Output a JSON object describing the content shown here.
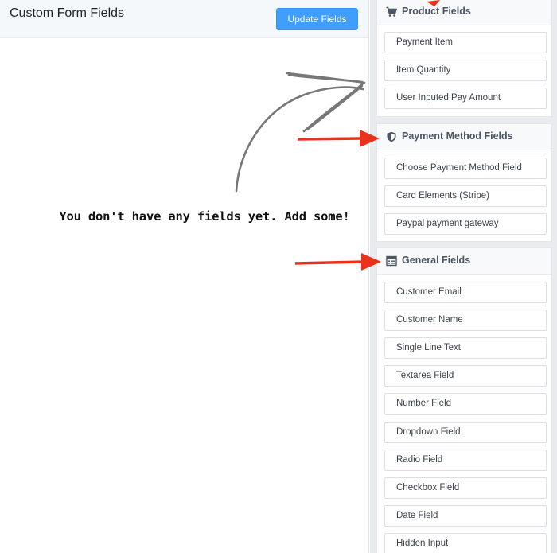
{
  "editor": {
    "title": "Custom Form Fields",
    "update_button": "Update Fields",
    "empty_message": "You don't have any fields yet. Add some!"
  },
  "sidebar": {
    "groups": [
      {
        "title": "Product Fields",
        "icon": "cart-icon",
        "fields": [
          "Payment Item",
          "Item Quantity",
          "User Inputed Pay Amount"
        ]
      },
      {
        "title": "Payment Method Fields",
        "icon": "shield-icon",
        "fields": [
          "Choose Payment Method Field",
          "Card Elements (Stripe)",
          "Paypal payment gateway"
        ]
      },
      {
        "title": "General Fields",
        "icon": "form-list-icon",
        "fields": [
          "Customer Email",
          "Customer Name",
          "Single Line Text",
          "Textarea Field",
          "Number Field",
          "Dropdown Field",
          "Radio Field",
          "Checkbox Field",
          "Date Field",
          "Hidden Input"
        ]
      }
    ]
  },
  "colors": {
    "primary_button": "#409eff",
    "annotation_arrow": "#e8321c",
    "sketch_arrow": "#777777"
  }
}
